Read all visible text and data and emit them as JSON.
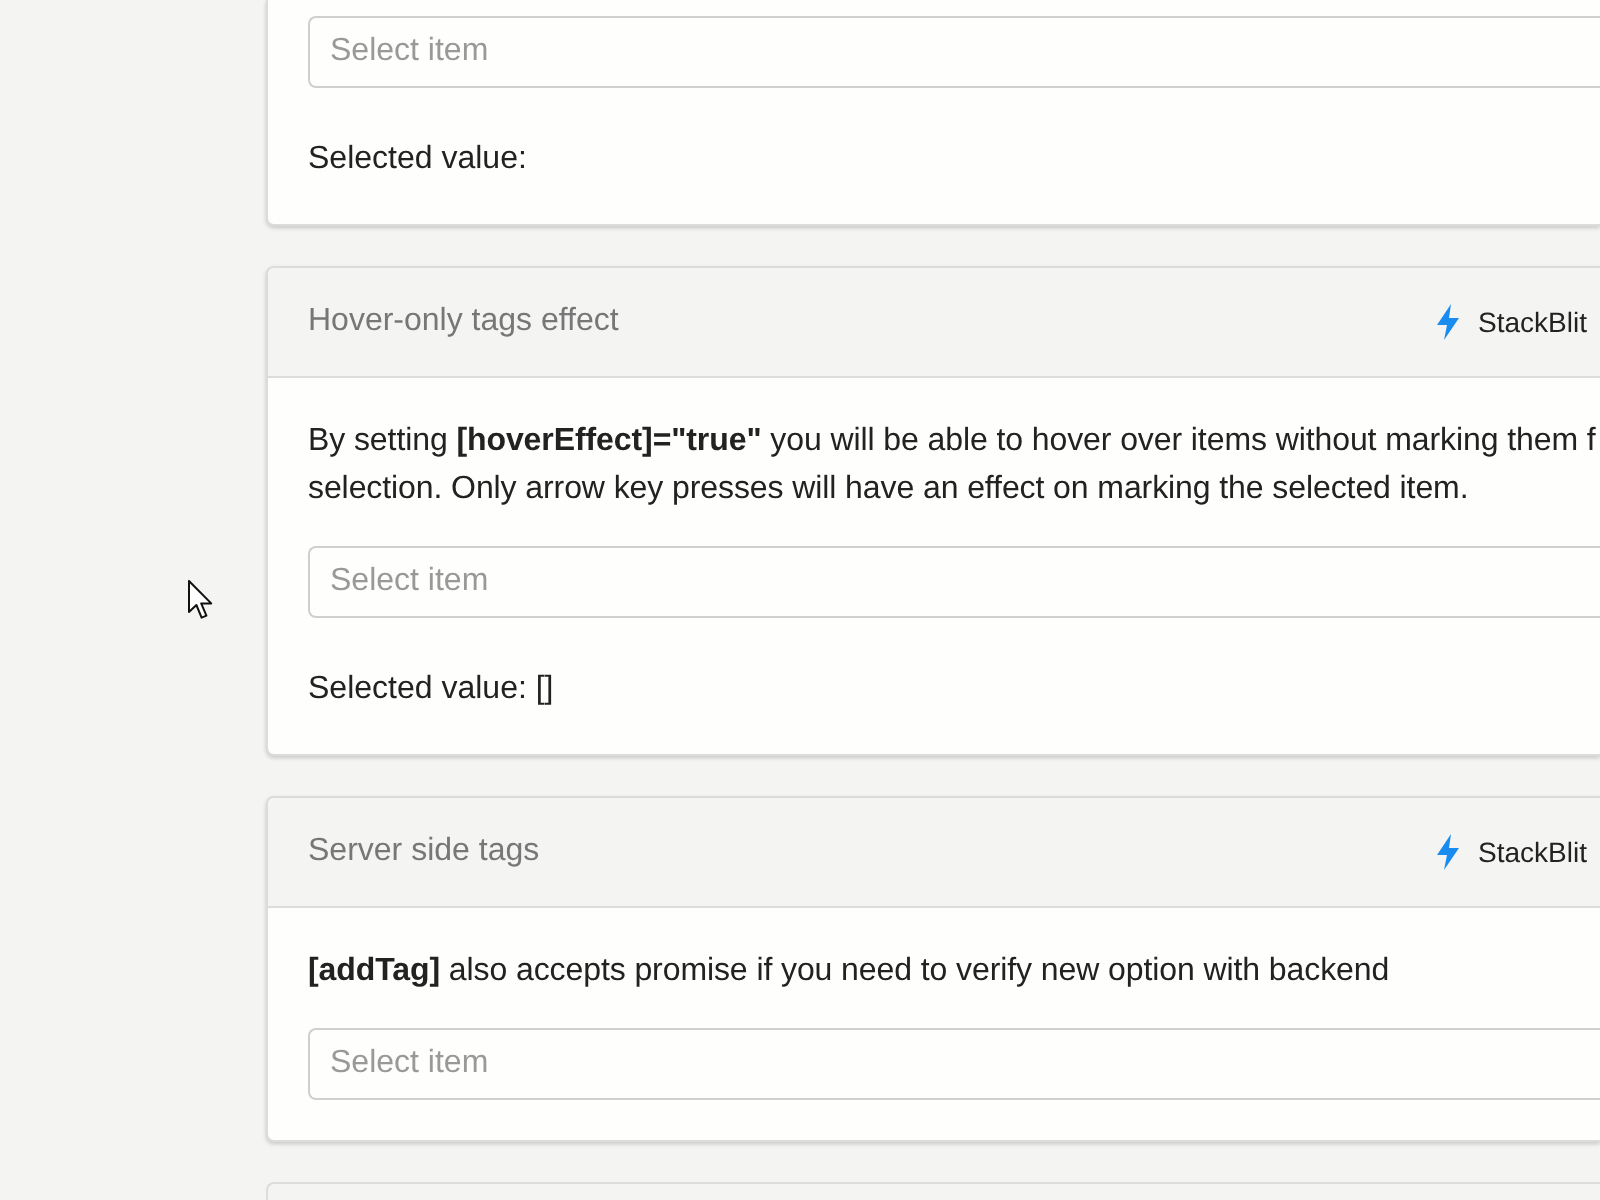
{
  "cards": [
    {
      "field": {
        "placeholder": "Select item"
      },
      "selected_value": "Selected value:"
    },
    {
      "title": "Hover-only tags effect",
      "link": "StackBlit",
      "description": [
        "By setting **[hoverEffect]=\"true\"** you will be able to hover over items without marking them f",
        "selection. Only arrow key presses will have an effect on marking the selected item."
      ],
      "field": {
        "placeholder": "Select item"
      },
      "selected_value": "Selected value: []"
    },
    {
      "title": "Server side tags",
      "link": "StackBlit",
      "description": [
        "**[addTag]** also accepts promise if you need to verify new option with backend"
      ],
      "field": {
        "placeholder": "Select item"
      }
    }
  ]
}
